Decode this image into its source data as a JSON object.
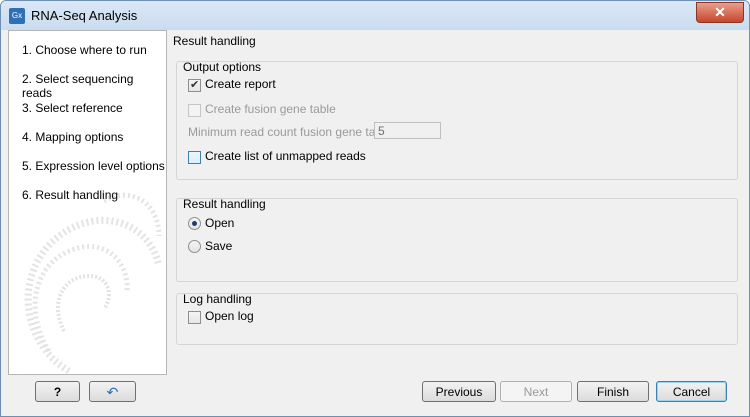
{
  "window": {
    "title": "RNA-Seq Analysis",
    "app_icon_text": "Gx",
    "close_symbol": "✕"
  },
  "steps": [
    "1.  Choose where to run",
    "2.  Select sequencing reads",
    "3.  Select reference",
    "4.  Mapping options",
    "5.  Expression level options",
    "6.  Result handling"
  ],
  "main": {
    "section_title": "Result handling",
    "output_options": {
      "label": "Output options",
      "create_report": {
        "label": "Create report",
        "checked": true
      },
      "create_fusion": {
        "label": "Create fusion gene table",
        "checked": false,
        "enabled": false
      },
      "min_read_count": {
        "label": "Minimum read count fusion gene table",
        "value": "5"
      },
      "unmapped": {
        "label": "Create list of unmapped reads",
        "checked": false
      }
    },
    "result_handling": {
      "label": "Result handling",
      "open": "Open",
      "save": "Save",
      "selected": "Open"
    },
    "log_handling": {
      "label": "Log handling",
      "open_log": {
        "label": "Open log",
        "checked": false
      }
    }
  },
  "buttons": {
    "help": "?",
    "reset": "↶",
    "previous": "Previous",
    "next": "Next",
    "finish": "Finish",
    "cancel": "Cancel"
  }
}
